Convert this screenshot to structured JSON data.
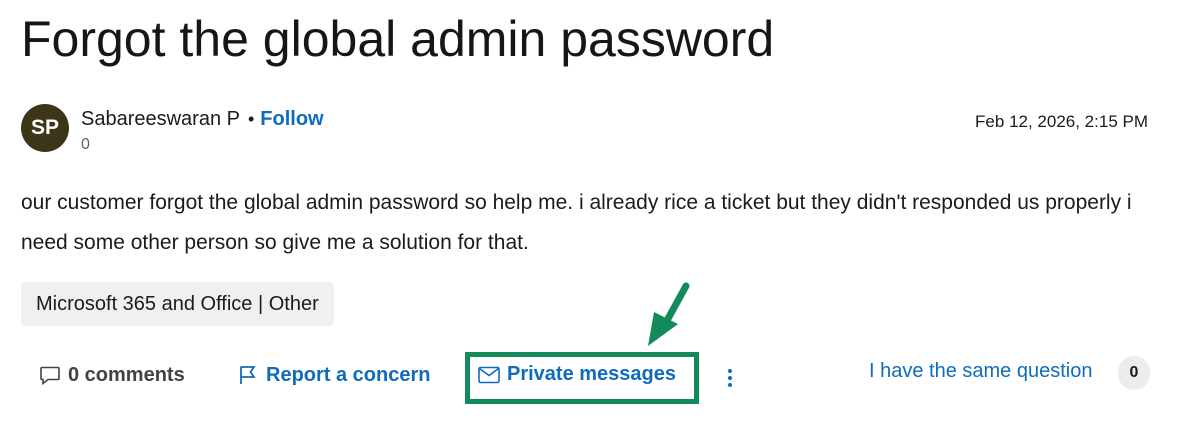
{
  "question": {
    "title": "Forgot the global admin password",
    "author": {
      "initials": "SP",
      "name": "Sabareeswaran P",
      "follow_label": "Follow",
      "reputation": "0"
    },
    "date": "Feb 12, 2026, 2:15 PM",
    "body": "our customer forgot the global admin password so help me. i already rice a ticket but they didn't responded us properly i need some other person so give me a solution for that.",
    "tag": "Microsoft 365 and Office | Other"
  },
  "actions": {
    "comments_label": "0 comments",
    "report_label": "Report a concern",
    "private_messages_label": "Private messages",
    "same_question_label": "I have the same question",
    "same_question_count": "0"
  },
  "icons": {
    "comments": "comment-icon",
    "report": "flag-icon",
    "private_messages": "mail-icon",
    "more": "more-vertical-icon"
  },
  "colors": {
    "link": "#0f6cbd",
    "avatar_bg": "#3d3518",
    "highlight": "#128a5a"
  }
}
